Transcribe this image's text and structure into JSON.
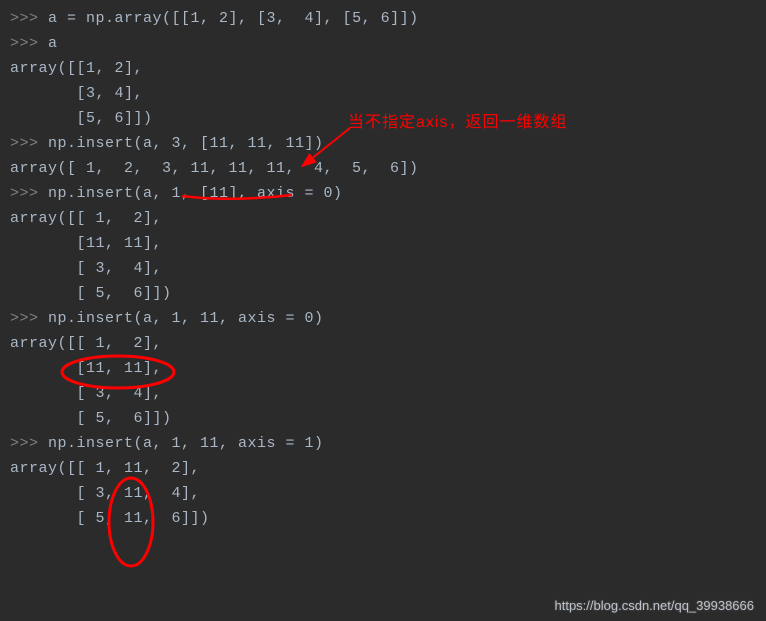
{
  "lines": [
    {
      "prompt": ">>> ",
      "text": "a = np.array([[1, 2], [3,  4], [5, 6]])"
    },
    {
      "prompt": ">>> ",
      "text": "a"
    },
    {
      "prompt": "",
      "text": "array([[1, 2],"
    },
    {
      "prompt": "",
      "text": "       [3, 4],"
    },
    {
      "prompt": "",
      "text": "       [5, 6]])"
    },
    {
      "prompt": ">>> ",
      "text": "np.insert(a, 3, [11, 11, 11])"
    },
    {
      "prompt": "",
      "text": "array([ 1,  2,  3, 11, 11, 11,  4,  5,  6])"
    },
    {
      "prompt": ">>> ",
      "text": "np.insert(a, 1, [11], axis = 0)"
    },
    {
      "prompt": "",
      "text": "array([[ 1,  2],"
    },
    {
      "prompt": "",
      "text": "       [11, 11],"
    },
    {
      "prompt": "",
      "text": "       [ 3,  4],"
    },
    {
      "prompt": "",
      "text": "       [ 5,  6]])"
    },
    {
      "prompt": ">>> ",
      "text": "np.insert(a, 1, 11, axis = 0)"
    },
    {
      "prompt": "",
      "text": "array([[ 1,  2],"
    },
    {
      "prompt": "",
      "text": "       [11, 11],"
    },
    {
      "prompt": "",
      "text": "       [ 3,  4],"
    },
    {
      "prompt": "",
      "text": "       [ 5,  6]])"
    },
    {
      "prompt": ">>> ",
      "text": "np.insert(a, 1, 11, axis = 1)"
    },
    {
      "prompt": "",
      "text": "array([[ 1, 11,  2],"
    },
    {
      "prompt": "",
      "text": "       [ 3, 11,  4],"
    },
    {
      "prompt": "",
      "text": "       [ 5, 11,  6]])"
    }
  ],
  "annotation": "当不指定axis，返回一维数组",
  "watermark": "https://blog.csdn.net/qq_39938666"
}
